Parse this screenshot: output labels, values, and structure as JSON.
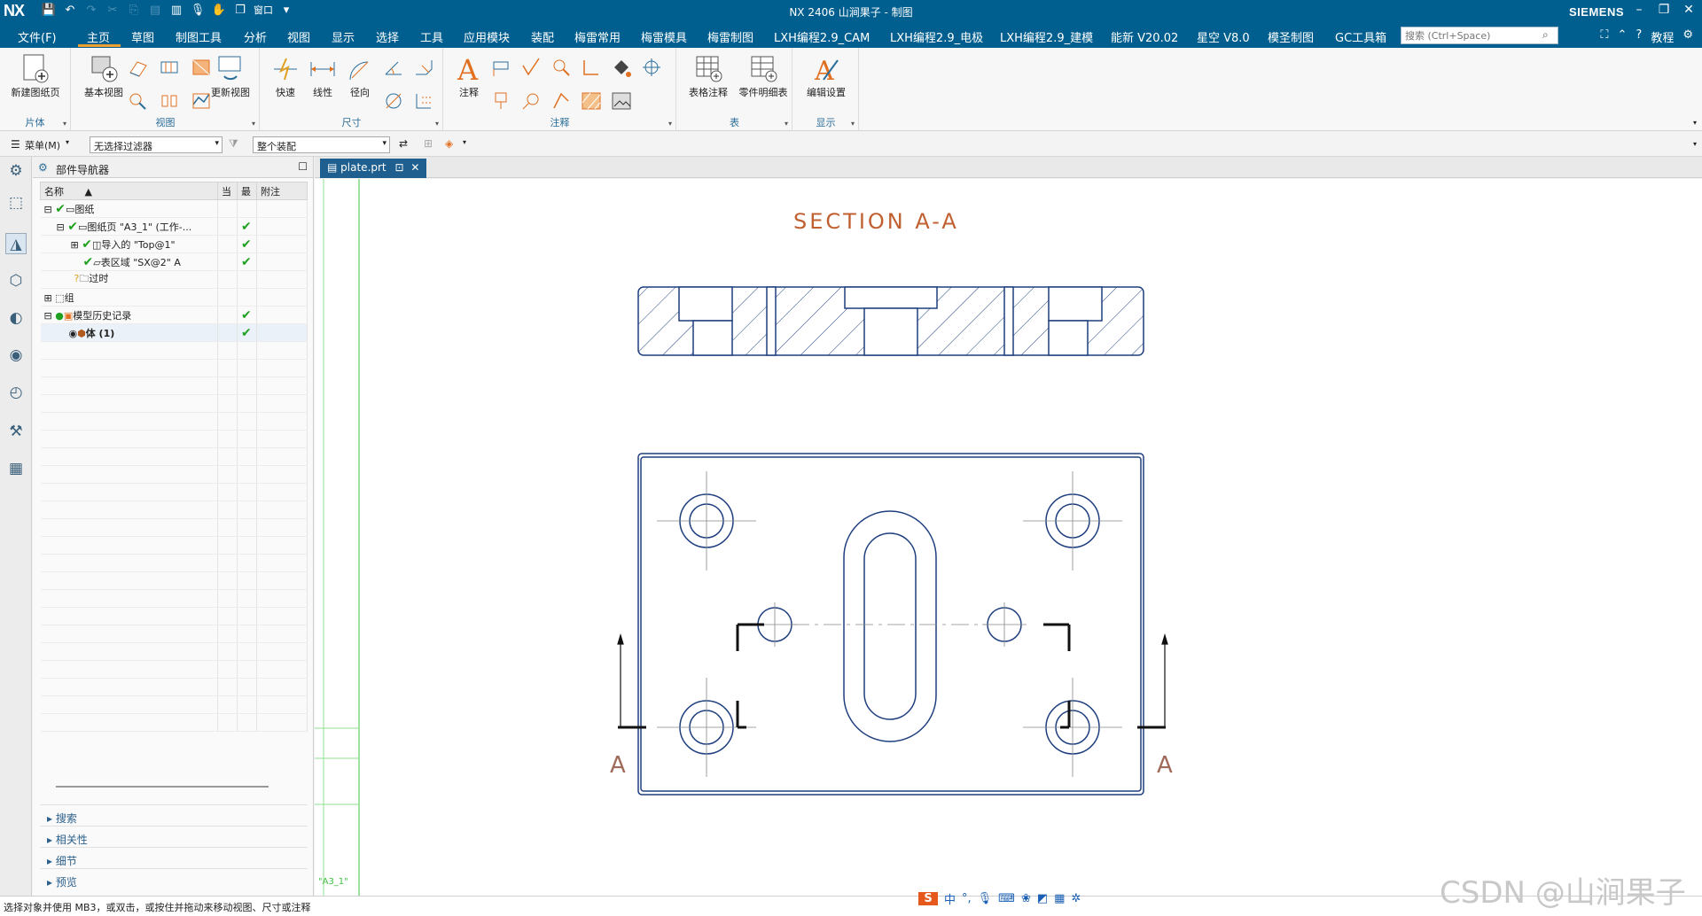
{
  "title": {
    "logo": "NX",
    "window_label": "窗口",
    "text": "NX 2406 山涧果子 - 制图",
    "brand": "SIEMENS"
  },
  "menu": {
    "items": [
      "文件(F)",
      "主页",
      "草图",
      "制图工具",
      "分析",
      "视图",
      "显示",
      "选择",
      "工具",
      "应用模块",
      "装配",
      "梅雷常用",
      "梅雷模具",
      "梅雷制图",
      "LXH编程2.9_CAM",
      "LXH编程2.9_电极",
      "LXH编程2.9_建模",
      "能新 V20.02",
      "星空 V8.0",
      "模圣制图",
      "GC工具箱"
    ],
    "search_placeholder": "搜索 (Ctrl+Space)",
    "help": "教程"
  },
  "ribbon": {
    "groups": {
      "sheet": "片体",
      "view": "视图",
      "dim": "尺寸",
      "anno": "注释",
      "table": "表",
      "display": "显示"
    },
    "buttons": {
      "new_sheet": "新建图纸页",
      "base_view": "基本视图",
      "update_view": "更新视图",
      "rapid": "快速",
      "linear": "线性",
      "radial": "径向",
      "note": "注释",
      "table_note": "表格注释",
      "parts_list": "零件明细表",
      "edit_settings": "编辑设置"
    }
  },
  "toolbar2": {
    "menu": "菜单(M)",
    "filter": "无选择过滤器",
    "scope": "整个装配"
  },
  "navigator": {
    "title": "部件导航器",
    "columns": [
      "名称",
      "当",
      "最",
      "附注"
    ],
    "rows": [
      {
        "name": "图纸",
        "cur": "",
        "latest": "",
        "note": ""
      },
      {
        "name": "图纸页 \"A3_1\" (工作-...",
        "cur": "",
        "latest": "✔",
        "note": ""
      },
      {
        "name": "导入的 \"Top@1\"",
        "cur": "",
        "latest": "✔",
        "note": ""
      },
      {
        "name": "表区域 \"SX@2\" A",
        "cur": "",
        "latest": "✔",
        "note": ""
      },
      {
        "name": "过时",
        "cur": "",
        "latest": "",
        "note": ""
      },
      {
        "name": "组",
        "cur": "",
        "latest": "",
        "note": ""
      },
      {
        "name": "模型历史记录",
        "cur": "",
        "latest": "✔",
        "note": ""
      },
      {
        "name": "体 (1)",
        "cur": "",
        "latest": "✔",
        "note": ""
      }
    ],
    "sections": [
      "搜索",
      "相关性",
      "细节",
      "预览"
    ]
  },
  "tab": {
    "name": "plate.prt"
  },
  "drawing": {
    "section_title": "SECTION  A-A",
    "label_left": "A",
    "label_right": "A",
    "sheet_label": "\"A3_1\""
  },
  "status": "选择对象并使用 MB3，或双击，或按住并拖动来移动视图、尺寸或注释",
  "ime": {
    "lang": "中"
  },
  "watermark": "CSDN @山涧果子",
  "colors": {
    "accent": "#005f8f",
    "drawing_line": "#1f3f7f",
    "section_title": "#c06030",
    "green_check": "#1fa01f"
  }
}
